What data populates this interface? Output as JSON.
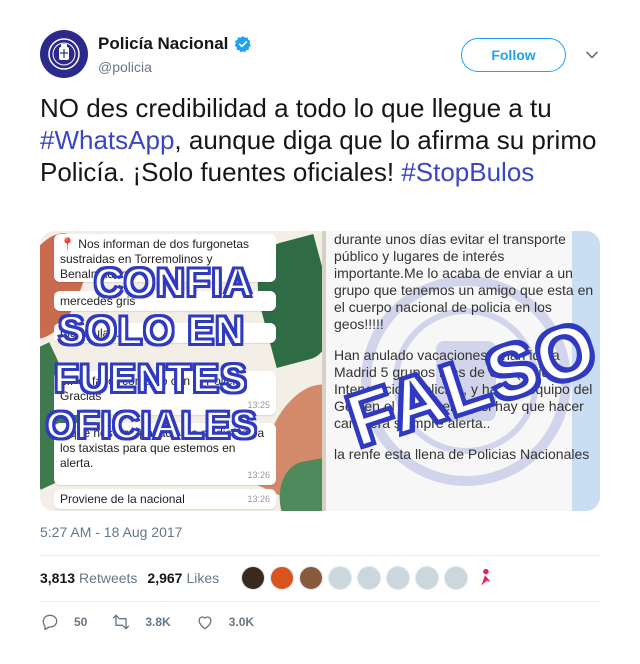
{
  "account": {
    "display_name": "Policía Nacional",
    "handle": "@policia",
    "verified": true,
    "avatar_icon": "police-crest-icon",
    "avatar_color": "#2b2a8c"
  },
  "follow_button": {
    "label": "Follow",
    "color": "#1da1f2"
  },
  "menu_icon": "chevron-down-icon",
  "tweet": {
    "text_part1": "NO des credibilidad a todo lo que llegue a tu ",
    "hashtag1": "#WhatsApp",
    "text_part2": ", aunque diga que lo afirma su primo Policía. ¡Solo fuentes oficiales! ",
    "hashtag2": "#StopBulos",
    "hashtag_color": "#3b46c5"
  },
  "media": {
    "left_panel": {
      "overlay_lines": [
        "CONFIA",
        "SOLO EN",
        "FUENTES",
        "OFICIALES"
      ],
      "messages": [
        {
          "text": "📍 Nos informan de dos furgonetas sustraidas en Torremolinos y Benalmadena",
          "time": ""
        },
        {
          "text": "mercedes gris",
          "time": ""
        },
        {
          "text": "matrícula...",
          "time": ""
        },
        {
          "text": "...Por favor contacto con la Policía Gracias",
          "time": "13:25"
        },
        {
          "text": "...que nos han pasado los sindicatos a los taxistas para que estemos en alerta.",
          "time": "13:26"
        },
        {
          "text": "Proviene de la nacional",
          "time": "13:26"
        }
      ]
    },
    "right_panel": {
      "overlay_word": "FALSO",
      "paragraphs": [
        "durante unos días evitar el transporte público y lugares de interés importante.Me lo acaba de enviar a un grupo que tenemos un amigo que esta en el cuerpo nacional de policia en los geos!!!!!",
        "Han anulado vacaciones y han ido a Madrid 5 grupos mas de UIP (Unidad de Intervencion Policial), y hay un equipo del Geo en el aeropuerto y si hay que hacer carretera siempre alerta..",
        "la renfe esta llena de Policias Nacionales"
      ]
    },
    "overlay_color": "#2f3ac0"
  },
  "timestamp": "5:27 AM - 18 Aug 2017",
  "stats": {
    "retweets_count": "3,813",
    "retweets_label": "Retweets",
    "likes_count": "2,967",
    "likes_label": "Likes"
  },
  "actions": {
    "replies": "50",
    "retweets": "3.8K",
    "likes": "3.0K"
  }
}
